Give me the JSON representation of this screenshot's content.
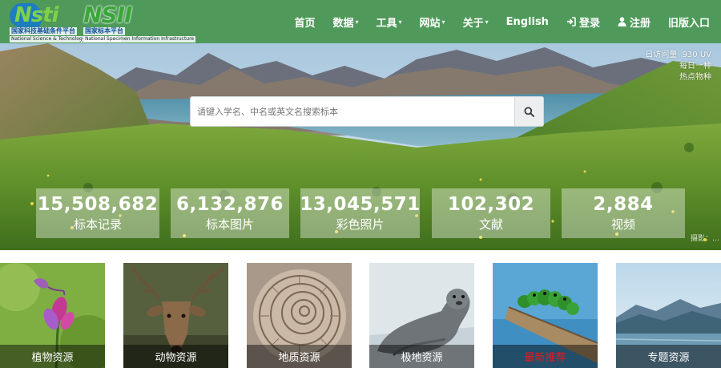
{
  "header": {
    "logo_left": {
      "word_a": "N",
      "word_b": "sti",
      "subtitle_cn": "国家科技基础条件平台",
      "subtitle_en": "National Science & Technology Infrastructure"
    },
    "logo_right": {
      "word_a": "NS",
      "word_b": "II",
      "subtitle_cn": "国家标本平台",
      "subtitle_en": "National Specimen Information Infrastructure"
    },
    "nav": [
      {
        "label": "首页",
        "dropdown": false
      },
      {
        "label": "数据",
        "dropdown": true
      },
      {
        "label": "工具",
        "dropdown": true
      },
      {
        "label": "网站",
        "dropdown": true
      },
      {
        "label": "关于",
        "dropdown": true
      },
      {
        "label": "English",
        "dropdown": false
      },
      {
        "label": "登录",
        "icon": "login-icon"
      },
      {
        "label": "注册",
        "icon": "user-icon"
      },
      {
        "label": "旧版入口",
        "dropdown": false
      }
    ],
    "caret": "▾"
  },
  "hero": {
    "search": {
      "placeholder": "请键入学名、中名或英文名搜索标本",
      "icon": "search-icon"
    },
    "visits": {
      "label": "日访问量",
      "value": "930 UV",
      "line2": "每日一种",
      "line3": "热点物种"
    },
    "photo_credit": "摄影：…",
    "stats": [
      {
        "value": "15,508,682",
        "label": "标本记录"
      },
      {
        "value": "6,132,876",
        "label": "标本图片"
      },
      {
        "value": "13,045,571",
        "label": "彩色照片"
      },
      {
        "value": "102,302",
        "label": "文献"
      },
      {
        "value": "2,884",
        "label": "视频"
      }
    ]
  },
  "tiles": [
    {
      "label": "植物资源",
      "highlight": false
    },
    {
      "label": "动物资源",
      "highlight": false
    },
    {
      "label": "地质资源",
      "highlight": false
    },
    {
      "label": "极地资源",
      "highlight": false
    },
    {
      "label": "最新推荐",
      "highlight": true
    },
    {
      "label": "专题资源",
      "highlight": false
    }
  ],
  "colors": {
    "header_bg": "#4f9a5a",
    "highlight_label": "#e41b1b"
  }
}
